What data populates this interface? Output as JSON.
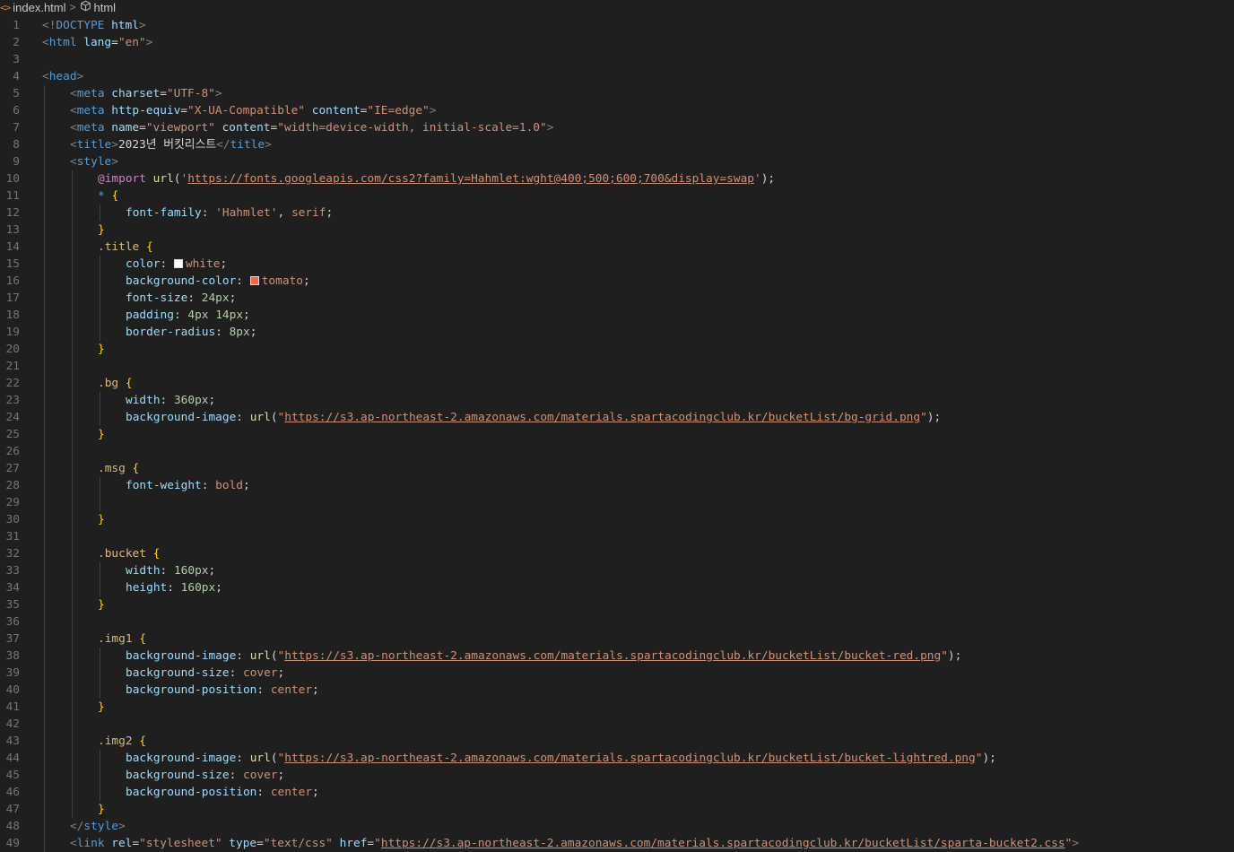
{
  "breadcrumb": {
    "file": "index.html",
    "file_icon": "<>",
    "symbol": "html",
    "separator": ">",
    "symbol_icon": "cube-icon"
  },
  "colors": {
    "punct": "#808080",
    "tag": "#569cd6",
    "attr": "#9cdcfe",
    "string": "#ce9178",
    "selector": "#d7ba7d",
    "brace": "#ffd700",
    "number": "#b5cea8",
    "keyword": "#c586c0",
    "function": "#dcdcaa",
    "line_number": "#6e7681",
    "background": "#1f1f1f",
    "swatch_white": "#ffffff",
    "swatch_tomato": "#ff6347"
  },
  "lines": [
    {
      "n": "1",
      "i": 0,
      "t": [
        [
          "punct",
          "<!"
        ],
        [
          "tag",
          "DOCTYPE"
        ],
        [
          "plain",
          " "
        ],
        [
          "attr",
          "html"
        ],
        [
          "punct",
          ">"
        ]
      ]
    },
    {
      "n": "2",
      "i": 0,
      "t": [
        [
          "punct",
          "<"
        ],
        [
          "tag",
          "html"
        ],
        [
          "plain",
          " "
        ],
        [
          "attr",
          "lang"
        ],
        [
          "plain",
          "="
        ],
        [
          "str",
          "\"en\""
        ],
        [
          "punct",
          ">"
        ]
      ]
    },
    {
      "n": "3",
      "i": 0,
      "t": []
    },
    {
      "n": "4",
      "i": 0,
      "t": [
        [
          "punct",
          "<"
        ],
        [
          "tag",
          "head"
        ],
        [
          "punct",
          ">"
        ]
      ]
    },
    {
      "n": "5",
      "i": 1,
      "t": [
        [
          "punct",
          "<"
        ],
        [
          "tag",
          "meta"
        ],
        [
          "plain",
          " "
        ],
        [
          "attr",
          "charset"
        ],
        [
          "plain",
          "="
        ],
        [
          "str",
          "\"UTF-8\""
        ],
        [
          "punct",
          ">"
        ]
      ]
    },
    {
      "n": "6",
      "i": 1,
      "t": [
        [
          "punct",
          "<"
        ],
        [
          "tag",
          "meta"
        ],
        [
          "plain",
          " "
        ],
        [
          "attr",
          "http-equiv"
        ],
        [
          "plain",
          "="
        ],
        [
          "str",
          "\"X-UA-Compatible\""
        ],
        [
          "plain",
          " "
        ],
        [
          "attr",
          "content"
        ],
        [
          "plain",
          "="
        ],
        [
          "str",
          "\"IE=edge\""
        ],
        [
          "punct",
          ">"
        ]
      ]
    },
    {
      "n": "7",
      "i": 1,
      "t": [
        [
          "punct",
          "<"
        ],
        [
          "tag",
          "meta"
        ],
        [
          "plain",
          " "
        ],
        [
          "attr",
          "name"
        ],
        [
          "plain",
          "="
        ],
        [
          "str",
          "\"viewport\""
        ],
        [
          "plain",
          " "
        ],
        [
          "attr",
          "content"
        ],
        [
          "plain",
          "="
        ],
        [
          "str",
          "\"width=device-width, initial-scale=1.0\""
        ],
        [
          "punct",
          ">"
        ]
      ]
    },
    {
      "n": "8",
      "i": 1,
      "t": [
        [
          "punct",
          "<"
        ],
        [
          "tag",
          "title"
        ],
        [
          "punct",
          ">"
        ],
        [
          "text",
          "2023년 버킷리스트"
        ],
        [
          "punct",
          "</"
        ],
        [
          "tag",
          "title"
        ],
        [
          "punct",
          ">"
        ]
      ]
    },
    {
      "n": "9",
      "i": 1,
      "t": [
        [
          "punct",
          "<"
        ],
        [
          "tag",
          "style"
        ],
        [
          "punct",
          ">"
        ]
      ]
    },
    {
      "n": "10",
      "i": 2,
      "t": [
        [
          "kw",
          "@import"
        ],
        [
          "plain",
          " "
        ],
        [
          "fn",
          "url"
        ],
        [
          "plain",
          "("
        ],
        [
          "str",
          "'"
        ],
        [
          "url",
          "https://fonts.googleapis.com/css2?family=Hahmlet:wght@400;500;600;700&display=swap"
        ],
        [
          "str",
          "'"
        ],
        [
          "plain",
          ");"
        ]
      ]
    },
    {
      "n": "11",
      "i": 2,
      "t": [
        [
          "tag",
          "*"
        ],
        [
          "plain",
          " "
        ],
        [
          "brace",
          "{"
        ]
      ]
    },
    {
      "n": "12",
      "i": 3,
      "t": [
        [
          "prop",
          "font-family"
        ],
        [
          "plain",
          ": "
        ],
        [
          "val",
          "'Hahmlet'"
        ],
        [
          "plain",
          ", "
        ],
        [
          "val",
          "serif"
        ],
        [
          "plain",
          ";"
        ]
      ]
    },
    {
      "n": "13",
      "i": 2,
      "t": [
        [
          "brace",
          "}"
        ]
      ]
    },
    {
      "n": "14",
      "i": 2,
      "t": [
        [
          "sel",
          ".title"
        ],
        [
          "plain",
          " "
        ],
        [
          "brace",
          "{"
        ]
      ]
    },
    {
      "n": "15",
      "i": 3,
      "t": [
        [
          "prop",
          "color"
        ],
        [
          "plain",
          ": "
        ],
        [
          "swatch",
          "#ffffff"
        ],
        [
          "val",
          "white"
        ],
        [
          "plain",
          ";"
        ]
      ]
    },
    {
      "n": "16",
      "i": 3,
      "t": [
        [
          "prop",
          "background-color"
        ],
        [
          "plain",
          ": "
        ],
        [
          "swatch",
          "#ff6347"
        ],
        [
          "val",
          "tomato"
        ],
        [
          "plain",
          ";"
        ]
      ]
    },
    {
      "n": "17",
      "i": 3,
      "t": [
        [
          "prop",
          "font-size"
        ],
        [
          "plain",
          ": "
        ],
        [
          "num",
          "24px"
        ],
        [
          "plain",
          ";"
        ]
      ]
    },
    {
      "n": "18",
      "i": 3,
      "t": [
        [
          "prop",
          "padding"
        ],
        [
          "plain",
          ": "
        ],
        [
          "num",
          "4px"
        ],
        [
          "plain",
          " "
        ],
        [
          "num",
          "14px"
        ],
        [
          "plain",
          ";"
        ]
      ]
    },
    {
      "n": "19",
      "i": 3,
      "t": [
        [
          "prop",
          "border-radius"
        ],
        [
          "plain",
          ": "
        ],
        [
          "num",
          "8px"
        ],
        [
          "plain",
          ";"
        ]
      ]
    },
    {
      "n": "20",
      "i": 2,
      "t": [
        [
          "brace",
          "}"
        ]
      ]
    },
    {
      "n": "21",
      "i": 2,
      "t": []
    },
    {
      "n": "22",
      "i": 2,
      "t": [
        [
          "sel",
          ".bg"
        ],
        [
          "plain",
          " "
        ],
        [
          "brace",
          "{"
        ]
      ]
    },
    {
      "n": "23",
      "i": 3,
      "t": [
        [
          "prop",
          "width"
        ],
        [
          "plain",
          ": "
        ],
        [
          "num",
          "360px"
        ],
        [
          "plain",
          ";"
        ]
      ]
    },
    {
      "n": "24",
      "i": 3,
      "t": [
        [
          "prop",
          "background-image"
        ],
        [
          "plain",
          ": "
        ],
        [
          "fn",
          "url"
        ],
        [
          "plain",
          "("
        ],
        [
          "str",
          "\""
        ],
        [
          "url",
          "https://s3.ap-northeast-2.amazonaws.com/materials.spartacodingclub.kr/bucketList/bg-grid.png"
        ],
        [
          "str",
          "\""
        ],
        [
          "plain",
          ");"
        ]
      ]
    },
    {
      "n": "25",
      "i": 2,
      "t": [
        [
          "brace",
          "}"
        ]
      ]
    },
    {
      "n": "26",
      "i": 2,
      "t": []
    },
    {
      "n": "27",
      "i": 2,
      "t": [
        [
          "sel",
          ".msg"
        ],
        [
          "plain",
          " "
        ],
        [
          "brace",
          "{"
        ]
      ]
    },
    {
      "n": "28",
      "i": 3,
      "t": [
        [
          "prop",
          "font-weight"
        ],
        [
          "plain",
          ": "
        ],
        [
          "val",
          "bold"
        ],
        [
          "plain",
          ";"
        ]
      ]
    },
    {
      "n": "29",
      "i": 3,
      "t": []
    },
    {
      "n": "30",
      "i": 2,
      "t": [
        [
          "brace",
          "}"
        ]
      ]
    },
    {
      "n": "31",
      "i": 2,
      "t": []
    },
    {
      "n": "32",
      "i": 2,
      "t": [
        [
          "sel",
          ".bucket"
        ],
        [
          "plain",
          " "
        ],
        [
          "brace",
          "{"
        ]
      ]
    },
    {
      "n": "33",
      "i": 3,
      "t": [
        [
          "prop",
          "width"
        ],
        [
          "plain",
          ": "
        ],
        [
          "num",
          "160px"
        ],
        [
          "plain",
          ";"
        ]
      ]
    },
    {
      "n": "34",
      "i": 3,
      "t": [
        [
          "prop",
          "height"
        ],
        [
          "plain",
          ": "
        ],
        [
          "num",
          "160px"
        ],
        [
          "plain",
          ";"
        ]
      ]
    },
    {
      "n": "35",
      "i": 2,
      "t": [
        [
          "brace",
          "}"
        ]
      ]
    },
    {
      "n": "36",
      "i": 2,
      "t": []
    },
    {
      "n": "37",
      "i": 2,
      "t": [
        [
          "sel",
          ".img1"
        ],
        [
          "plain",
          " "
        ],
        [
          "brace",
          "{"
        ]
      ]
    },
    {
      "n": "38",
      "i": 3,
      "t": [
        [
          "prop",
          "background-image"
        ],
        [
          "plain",
          ": "
        ],
        [
          "fn",
          "url"
        ],
        [
          "plain",
          "("
        ],
        [
          "str",
          "\""
        ],
        [
          "url",
          "https://s3.ap-northeast-2.amazonaws.com/materials.spartacodingclub.kr/bucketList/bucket-red.png"
        ],
        [
          "str",
          "\""
        ],
        [
          "plain",
          ");"
        ]
      ]
    },
    {
      "n": "39",
      "i": 3,
      "t": [
        [
          "prop",
          "background-size"
        ],
        [
          "plain",
          ": "
        ],
        [
          "val",
          "cover"
        ],
        [
          "plain",
          ";"
        ]
      ]
    },
    {
      "n": "40",
      "i": 3,
      "t": [
        [
          "prop",
          "background-position"
        ],
        [
          "plain",
          ": "
        ],
        [
          "val",
          "center"
        ],
        [
          "plain",
          ";"
        ]
      ]
    },
    {
      "n": "41",
      "i": 2,
      "t": [
        [
          "brace",
          "}"
        ]
      ]
    },
    {
      "n": "42",
      "i": 2,
      "t": []
    },
    {
      "n": "43",
      "i": 2,
      "t": [
        [
          "sel",
          ".img2"
        ],
        [
          "plain",
          " "
        ],
        [
          "brace",
          "{"
        ]
      ]
    },
    {
      "n": "44",
      "i": 3,
      "t": [
        [
          "prop",
          "background-image"
        ],
        [
          "plain",
          ": "
        ],
        [
          "fn",
          "url"
        ],
        [
          "plain",
          "("
        ],
        [
          "str",
          "\""
        ],
        [
          "url",
          "https://s3.ap-northeast-2.amazonaws.com/materials.spartacodingclub.kr/bucketList/bucket-lightred.png"
        ],
        [
          "str",
          "\""
        ],
        [
          "plain",
          ");"
        ]
      ]
    },
    {
      "n": "45",
      "i": 3,
      "t": [
        [
          "prop",
          "background-size"
        ],
        [
          "plain",
          ": "
        ],
        [
          "val",
          "cover"
        ],
        [
          "plain",
          ";"
        ]
      ]
    },
    {
      "n": "46",
      "i": 3,
      "t": [
        [
          "prop",
          "background-position"
        ],
        [
          "plain",
          ": "
        ],
        [
          "val",
          "center"
        ],
        [
          "plain",
          ";"
        ]
      ]
    },
    {
      "n": "47",
      "i": 2,
      "t": [
        [
          "brace",
          "}"
        ]
      ]
    },
    {
      "n": "48",
      "i": 1,
      "t": [
        [
          "punct",
          "</"
        ],
        [
          "tag",
          "style"
        ],
        [
          "punct",
          ">"
        ]
      ]
    },
    {
      "n": "49",
      "i": 1,
      "t": [
        [
          "punct",
          "<"
        ],
        [
          "tag",
          "link"
        ],
        [
          "plain",
          " "
        ],
        [
          "attr",
          "rel"
        ],
        [
          "plain",
          "="
        ],
        [
          "str",
          "\"stylesheet\""
        ],
        [
          "plain",
          " "
        ],
        [
          "attr",
          "type"
        ],
        [
          "plain",
          "="
        ],
        [
          "str",
          "\"text/css\""
        ],
        [
          "plain",
          " "
        ],
        [
          "attr",
          "href"
        ],
        [
          "plain",
          "="
        ],
        [
          "str",
          "\""
        ],
        [
          "url",
          "https://s3.ap-northeast-2.amazonaws.com/materials.spartacodingclub.kr/bucketList/sparta-bucket2.css"
        ],
        [
          "str",
          "\""
        ],
        [
          "punct",
          ">"
        ]
      ]
    }
  ]
}
